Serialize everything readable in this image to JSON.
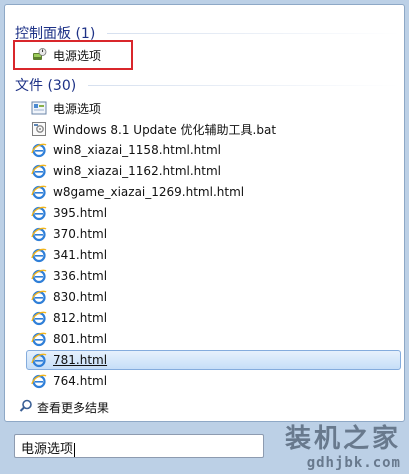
{
  "control_panel": {
    "header": "控制面板 (1)",
    "items": [
      {
        "label": "电源选项",
        "icon": "power-options-icon"
      }
    ]
  },
  "files": {
    "header": "文件 (30)",
    "items": [
      {
        "label": "电源选项",
        "icon": "power-options-file-icon"
      },
      {
        "label": "Windows 8.1 Update 优化辅助工具.bat",
        "icon": "batch-file-icon"
      },
      {
        "label": "win8_xiazai_1158.html.html",
        "icon": "ie-html-icon"
      },
      {
        "label": "win8_xiazai_1162.html.html",
        "icon": "ie-html-icon"
      },
      {
        "label": "w8game_xiazai_1269.html.html",
        "icon": "ie-html-icon"
      },
      {
        "label": "395.html",
        "icon": "ie-html-icon"
      },
      {
        "label": "370.html",
        "icon": "ie-html-icon"
      },
      {
        "label": "341.html",
        "icon": "ie-html-icon"
      },
      {
        "label": "336.html",
        "icon": "ie-html-icon"
      },
      {
        "label": "830.html",
        "icon": "ie-html-icon"
      },
      {
        "label": "812.html",
        "icon": "ie-html-icon"
      },
      {
        "label": "801.html",
        "icon": "ie-html-icon"
      },
      {
        "label": "781.html",
        "icon": "ie-html-icon",
        "highlighted": true
      },
      {
        "label": "764.html",
        "icon": "ie-html-icon"
      }
    ]
  },
  "see_more": {
    "label": "查看更多结果",
    "icon": "search-icon"
  },
  "search": {
    "value": "电源选项"
  },
  "watermark": {
    "line1": "装机之家",
    "line2": "gdhjbk.com"
  },
  "colors": {
    "header_text": "#1e3287",
    "highlight_border": "#84acdd",
    "red_box": "#d9262b"
  }
}
